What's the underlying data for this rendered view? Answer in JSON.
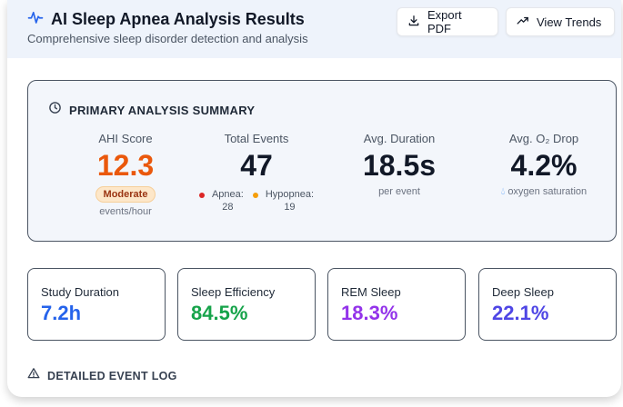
{
  "header": {
    "title": "AI Sleep Apnea Analysis Results",
    "subtitle": "Comprehensive sleep disorder detection and analysis",
    "buttons": {
      "export": "Export PDF",
      "trends": "View Trends"
    },
    "icon": "activity-pulse-icon"
  },
  "summary": {
    "title": "PRIMARY ANALYSIS SUMMARY",
    "ahi": {
      "label": "AHI Score",
      "value": "12.3",
      "badge": "Moderate",
      "unit": "events/hour",
      "color": "#ea580c"
    },
    "total_events": {
      "label": "Total Events",
      "value": "47",
      "apnea": {
        "label": "Apnea:",
        "count": "28",
        "color": "#dc2626"
      },
      "hypopnea": {
        "label": "Hypopnea:",
        "count": "19",
        "color": "#f59e0b"
      }
    },
    "avg_duration": {
      "label": "Avg. Duration",
      "value": "18.5s",
      "sub": "per event"
    },
    "avg_o2_drop": {
      "label": "Avg. O₂ Drop",
      "value": "4.2%",
      "sub": "oxygen saturation"
    }
  },
  "cards": [
    {
      "label": "Study Duration",
      "value": "7.2h",
      "color": "#2563eb"
    },
    {
      "label": "Sleep Efficiency",
      "value": "84.5%",
      "color": "#16a34a"
    },
    {
      "label": "REM Sleep",
      "value": "18.3%",
      "color": "#9333ea"
    },
    {
      "label": "Deep Sleep",
      "value": "22.1%",
      "color": "#4f46e5"
    }
  ],
  "event_log": {
    "title": "DETAILED EVENT LOG"
  }
}
